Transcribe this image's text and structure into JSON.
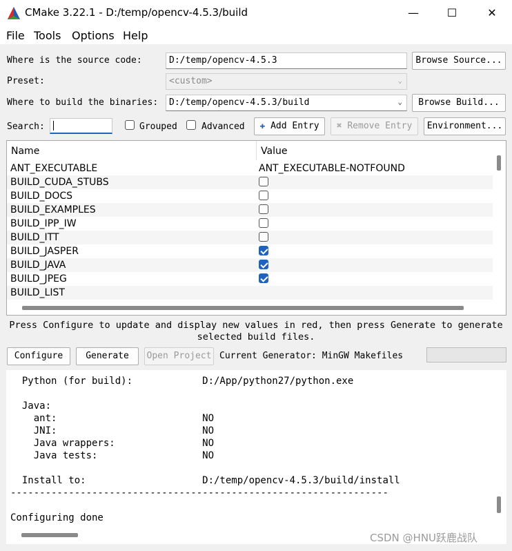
{
  "window": {
    "title": "CMake 3.22.1 - D:/temp/opencv-4.5.3/build",
    "controls": {
      "minimize": "—",
      "maximize": "☐",
      "close": "✕"
    }
  },
  "menu": [
    "File",
    "Tools",
    "Options",
    "Help"
  ],
  "source": {
    "label": "Where is the source code:",
    "value": "D:/temp/opencv-4.5.3",
    "button": "Browse Source..."
  },
  "preset": {
    "label": "Preset:",
    "value": "<custom>"
  },
  "build": {
    "label": "Where to build the binaries:",
    "value": "D:/temp/opencv-4.5.3/build",
    "button": "Browse Build..."
  },
  "toolbar": {
    "search_label": "Search:",
    "search_value": "",
    "grouped": "Grouped",
    "advanced": "Advanced",
    "add_entry": "Add Entry",
    "remove_entry": "Remove Entry",
    "environment": "Environment..."
  },
  "cache_table": {
    "headers": [
      "Name",
      "Value"
    ],
    "rows": [
      {
        "name": "ANT_EXECUTABLE",
        "value": "ANT_EXECUTABLE-NOTFOUND",
        "type": "text"
      },
      {
        "name": "BUILD_CUDA_STUBS",
        "type": "bool",
        "checked": false
      },
      {
        "name": "BUILD_DOCS",
        "type": "bool",
        "checked": false
      },
      {
        "name": "BUILD_EXAMPLES",
        "type": "bool",
        "checked": false
      },
      {
        "name": "BUILD_IPP_IW",
        "type": "bool",
        "checked": false
      },
      {
        "name": "BUILD_ITT",
        "type": "bool",
        "checked": false
      },
      {
        "name": "BUILD_JASPER",
        "type": "bool",
        "checked": true
      },
      {
        "name": "BUILD_JAVA",
        "type": "bool",
        "checked": true
      },
      {
        "name": "BUILD_JPEG",
        "type": "bool",
        "checked": true
      },
      {
        "name": "BUILD_LIST",
        "value": "",
        "type": "text"
      }
    ]
  },
  "hint": {
    "line1": "Press Configure to update and display new values in red, then press Generate to generate",
    "line2": "selected build files."
  },
  "actions": {
    "configure": "Configure",
    "generate": "Generate",
    "open_project": "Open Project",
    "generator_text": "Current Generator: MinGW Makefiles"
  },
  "output_lines": [
    "  Python (for build):            D:/App/python27/python.exe",
    "",
    "  Java:",
    "    ant:                         NO",
    "    JNI:                         NO",
    "    Java wrappers:               NO",
    "    Java tests:                  NO",
    "",
    "  Install to:                    D:/temp/opencv-4.5.3/build/install",
    "-----------------------------------------------------------------",
    "",
    "Configuring done"
  ],
  "watermark": "CSDN @HNU跃鹿战队",
  "colors": {
    "checkbox_checked": "#1f63bf",
    "window_bg": "#f0f0f0"
  }
}
